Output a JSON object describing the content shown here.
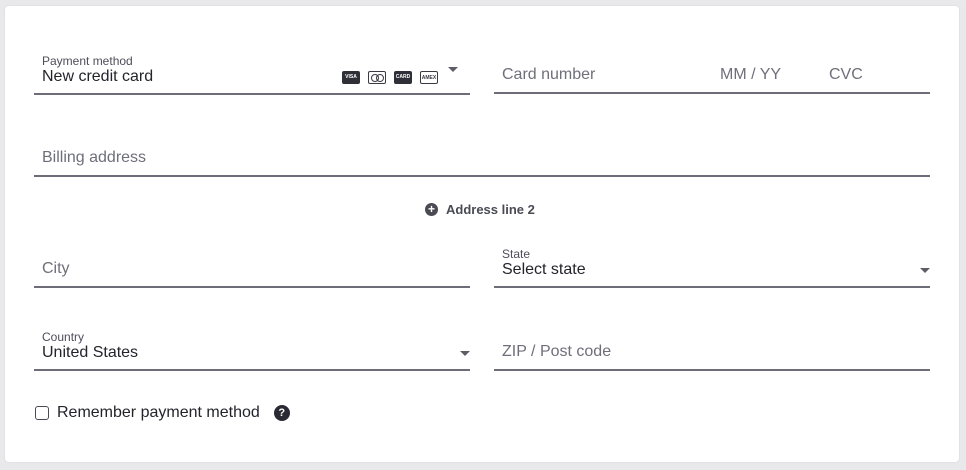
{
  "payment": {
    "label": "Payment method",
    "value": "New credit card",
    "brands": [
      "visa-icon",
      "mastercard-icon",
      "card-icon",
      "amex-icon"
    ]
  },
  "card": {
    "number_placeholder": "Card number",
    "expiry_placeholder": "MM / YY",
    "cvc_placeholder": "CVC"
  },
  "billing": {
    "placeholder": "Billing address"
  },
  "address_line2": {
    "label": "Address line 2"
  },
  "city": {
    "placeholder": "City"
  },
  "state": {
    "label": "State",
    "value": "Select state"
  },
  "country": {
    "label": "Country",
    "value": "United States"
  },
  "zip": {
    "placeholder": "ZIP / Post code"
  },
  "remember": {
    "label": "Remember payment method",
    "checked": false
  },
  "help_icon": {
    "glyph": "?"
  },
  "brand_text": {
    "visa": "VISA",
    "amex": "AMEX",
    "generic": "CARD"
  }
}
